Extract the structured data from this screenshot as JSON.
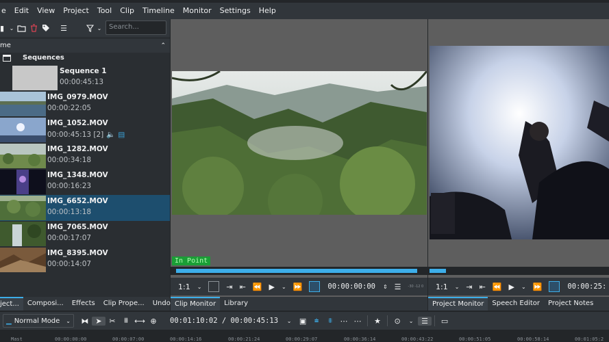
{
  "menu": [
    "e",
    "Edit",
    "View",
    "Project",
    "Tool",
    "Clip",
    "Timeline",
    "Monitor",
    "Settings",
    "Help"
  ],
  "bin": {
    "search_placeholder": "Search...",
    "header": "me",
    "folder": "Sequences",
    "clips": [
      {
        "name": "Sequence 1",
        "duration": "00:00:45:13"
      },
      {
        "name": "IMG_0979.MOV",
        "duration": "00:00:22:05"
      },
      {
        "name": "IMG_1052.MOV",
        "duration": "00:00:45:13 [2]"
      },
      {
        "name": "IMG_1282.MOV",
        "duration": "00:00:34:18"
      },
      {
        "name": "IMG_1348.MOV",
        "duration": "00:00:16:23"
      },
      {
        "name": "IMG_6652.MOV",
        "duration": "00:00:13:18"
      },
      {
        "name": "IMG_7065.MOV",
        "duration": "00:00:17:07"
      },
      {
        "name": "IMG_8395.MOV",
        "duration": "00:00:14:07"
      }
    ],
    "selected_index": 5
  },
  "left_tabs": [
    "ject...",
    "Composi...",
    "Effects",
    "Clip Prope...",
    "Undo Hi..."
  ],
  "clip_monitor": {
    "in_point_label": "In Point",
    "zoom": "1:1",
    "timecode": "00:00:00:00",
    "progress": 0.97,
    "meter_labels": "-30 -12 0"
  },
  "mid_tabs": [
    "Clip Monitor",
    "Library"
  ],
  "project_monitor": {
    "zoom": "1:1",
    "timecode": "00:00:25:"
  },
  "right_tabs": [
    "Project Monitor",
    "Speech Editor",
    "Project Notes"
  ],
  "timeline_toolbar": {
    "mode": "Normal Mode",
    "timecode": "00:01:10:02 / 00:00:45:13"
  },
  "ruler_ticks": [
    "Mast",
    "00:00:00:00",
    "00:00:07:00",
    "00:00:14:16",
    "00:00:21:24",
    "00:00:29:07",
    "00:00:36:14",
    "00:00:43:22",
    "00:00:51:05",
    "00:00:58:14",
    "00:01:05:2"
  ]
}
